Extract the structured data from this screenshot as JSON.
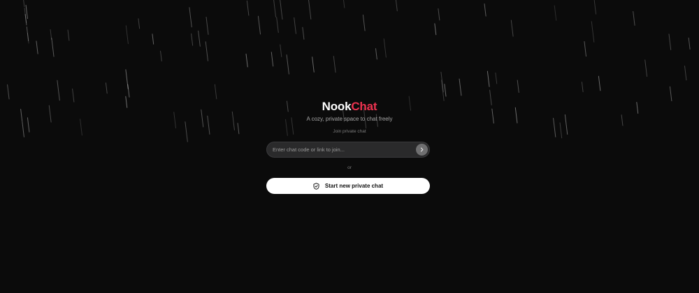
{
  "brand": {
    "name_part1": "Nook",
    "name_part2": "Chat",
    "accent_color": "#ee3350",
    "tagline": "A cozy, private space to chat freely"
  },
  "join": {
    "label": "Join private chat",
    "placeholder": "Enter chat code or link to join...",
    "value": "",
    "submit_icon": "chevron-right-icon"
  },
  "divider": {
    "label": "or"
  },
  "start": {
    "icon": "shield-icon",
    "label": "Start new private chat"
  },
  "theme": {
    "background": "#0b0b0b",
    "button_background": "#ffffff",
    "input_background": "#2a2a2b"
  }
}
